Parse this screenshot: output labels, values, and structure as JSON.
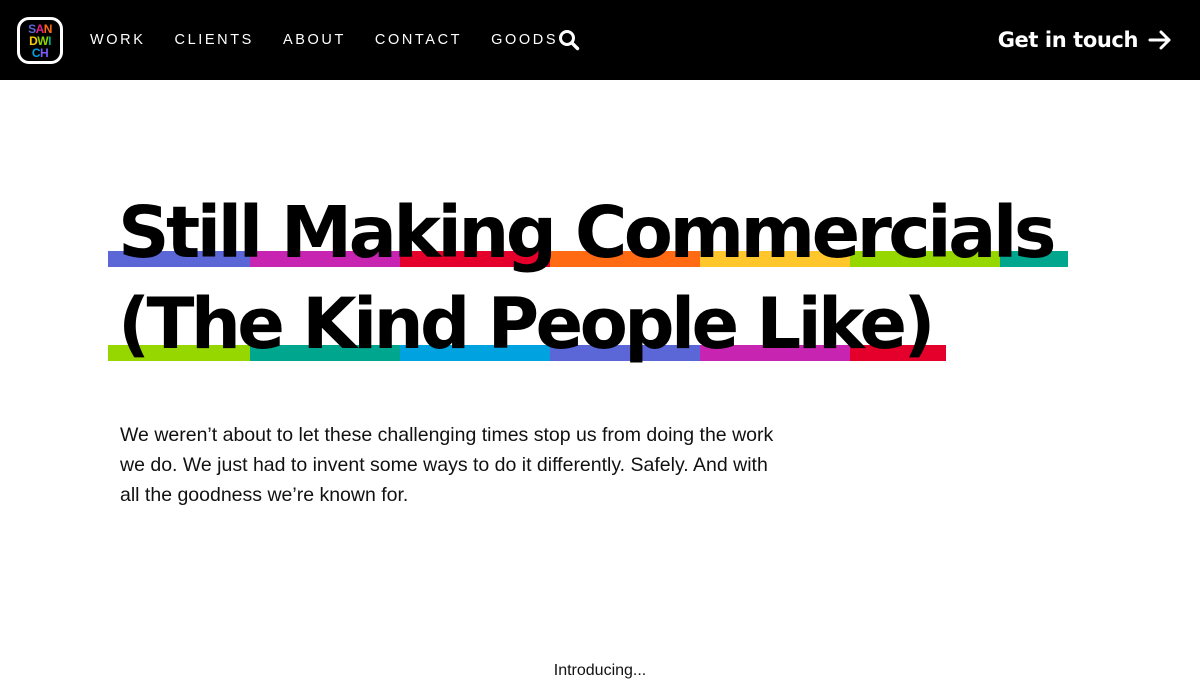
{
  "header": {
    "logo": {
      "rows": [
        [
          {
            "ch": "S",
            "color": "#5b67d6"
          },
          {
            "ch": "A",
            "color": "#e0218a"
          },
          {
            "ch": "N",
            "color": "#ff6a13"
          }
        ],
        [
          {
            "ch": "D",
            "color": "#ffcc00"
          },
          {
            "ch": "W",
            "color": "#8fd400"
          },
          {
            "ch": "I",
            "color": "#00b388"
          }
        ],
        [
          {
            "ch": "C",
            "color": "#00a3e0"
          },
          {
            "ch": "H",
            "color": "#7a5cff"
          },
          {
            "ch": "",
            "color": "#e4002b"
          }
        ]
      ]
    },
    "nav": [
      {
        "label": "WORK"
      },
      {
        "label": "CLIENTS"
      },
      {
        "label": "ABOUT"
      },
      {
        "label": "CONTACT"
      },
      {
        "label": "GOODS"
      }
    ],
    "search_icon": "search-icon",
    "cta": {
      "label": "Get in touch",
      "icon": "arrow-right-icon"
    }
  },
  "hero": {
    "line1": "Still Making Commercials",
    "line2": "(The Kind People Like)",
    "stripe_colors": [
      "#5b67d6",
      "#c724b1",
      "#e4002b",
      "#ff6a13",
      "#ffc72c",
      "#97d700",
      "#00a78e",
      "#00a3e0"
    ]
  },
  "intro": {
    "text": "We weren’t about to let these challenging times stop us from doing the work we do. We just had to invent some ways to do it differently. Safely. And with all the goodness we’re known for."
  },
  "introducing": "Introducing..."
}
